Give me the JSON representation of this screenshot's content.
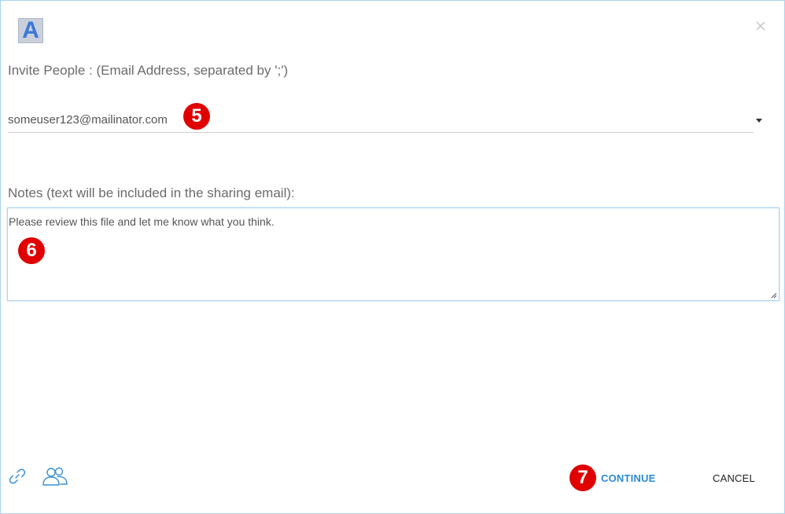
{
  "header": {
    "logo_letter": "A",
    "logo_icon": "app-logo",
    "close_icon": "close-icon"
  },
  "invite": {
    "label": "Invite People : (Email Address, separated by ';')",
    "email_value": "someuser123@mailinator.com",
    "dropdown_icon": "chevron-down-icon"
  },
  "notes": {
    "label": "Notes (text will be included in the sharing email):",
    "value": "Please review this file and let me know what you think."
  },
  "badges": {
    "step5": "5",
    "step6": "6",
    "step7": "7",
    "color": "#e00000"
  },
  "footer": {
    "link_icon": "link-icon",
    "people_icon": "people-icon",
    "continue_label": "CONTINUE",
    "cancel_label": "CANCEL"
  },
  "colors": {
    "accent": "#2b8ad8",
    "border": "#a9d3ee",
    "label_text": "#6b6b6b"
  }
}
